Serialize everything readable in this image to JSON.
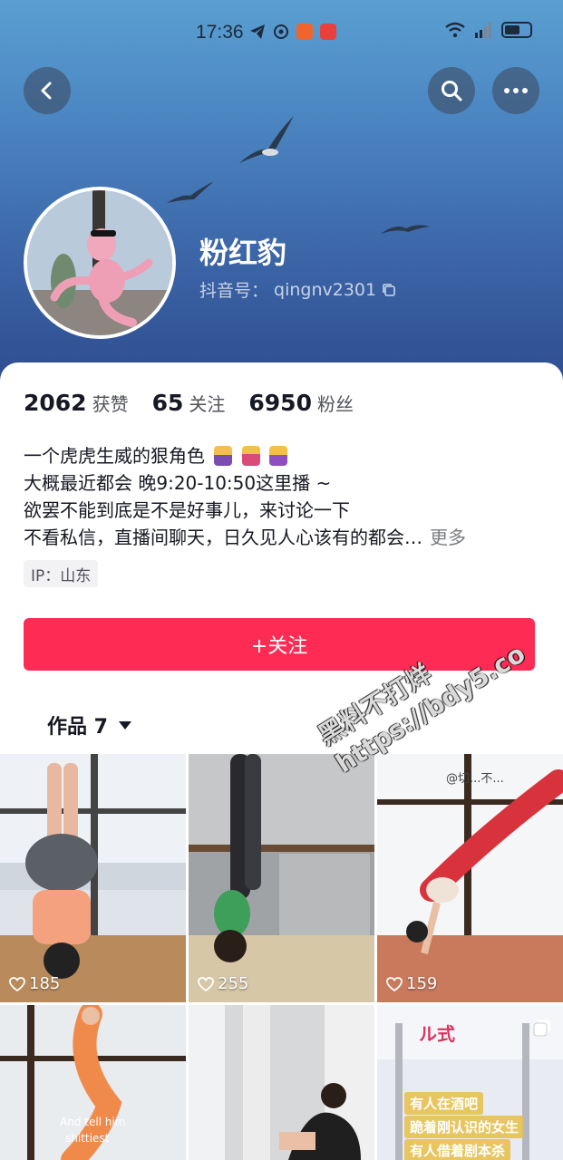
{
  "status_bar": {
    "time": "17:36",
    "icons": [
      "telegram-icon",
      "app-icon",
      "app-icon",
      "app-icon",
      "wifi-icon",
      "signal-icon",
      "battery-icon"
    ]
  },
  "header": {
    "back_icon": "chevron-left-icon",
    "search_icon": "search-icon",
    "more_icon": "more-horizontal-icon"
  },
  "profile": {
    "nickname": "粉红豹",
    "id_label": "抖音号：",
    "id_value": "qingnv2301",
    "copy_icon": "copy-icon"
  },
  "stats": [
    {
      "value": "2062",
      "label": "获赞"
    },
    {
      "value": "65",
      "label": "关注"
    },
    {
      "value": "6950",
      "label": "粉丝"
    }
  ],
  "bio": {
    "line1": "一个虎虎生威的狠角色",
    "line2": "大概最近都会 晚9:20-10:50这里播 ~",
    "line3": "欲罢不能到底是不是好事儿，来讨论一下",
    "line4": "不看私信，直播间聊天，日久见人心该有的都会…",
    "more": "更多"
  },
  "ip": "IP：山东",
  "follow_button": "+关注",
  "works_tab": {
    "label": "作品 7"
  },
  "videos": [
    {
      "likes": "185"
    },
    {
      "likes": "255"
    },
    {
      "likes": "159"
    },
    {
      "likes": ""
    },
    {
      "likes": ""
    },
    {
      "likes": ""
    }
  ],
  "video_overlays": {
    "tile3_caption": "@切...不...",
    "tile4_caption1": "And tell him",
    "tile4_caption2": "shittiest",
    "tile6_title": "ル式",
    "tile6_line1": "有人在酒吧",
    "tile6_line2": "跪着刚认识的女生",
    "tile6_line3": "有人借着剧本杀"
  },
  "watermark": {
    "line1": "黑料不打烊",
    "line2": "https://bdy5.co"
  },
  "colors": {
    "accent": "#fe2c55",
    "header_gradient_top": "#5a9fd1",
    "header_gradient_bottom": "#2e4c8e"
  }
}
